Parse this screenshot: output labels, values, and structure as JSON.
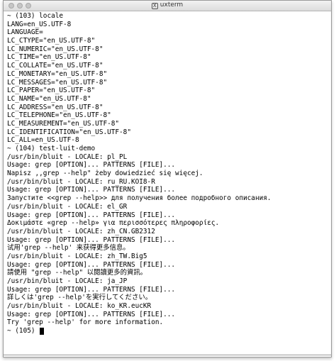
{
  "window": {
    "title": "uxterm",
    "title_icon": "x11-icon"
  },
  "terminal": {
    "lines": [
      "~ (103) locale",
      "LANG=en_US.UTF-8",
      "LANGUAGE=",
      "LC_CTYPE=\"en_US.UTF-8\"",
      "LC_NUMERIC=\"en_US.UTF-8\"",
      "LC_TIME=\"en_US.UTF-8\"",
      "LC_COLLATE=\"en_US.UTF-8\"",
      "LC_MONETARY=\"en_US.UTF-8\"",
      "LC_MESSAGES=\"en_US.UTF-8\"",
      "LC_PAPER=\"en_US.UTF-8\"",
      "LC_NAME=\"en_US.UTF-8\"",
      "LC_ADDRESS=\"en_US.UTF-8\"",
      "LC_TELEPHONE=\"en_US.UTF-8\"",
      "LC_MEASUREMENT=\"en_US.UTF-8\"",
      "LC_IDENTIFICATION=\"en_US.UTF-8\"",
      "LC_ALL=en_US.UTF-8",
      "~ (104) test-luit-demo",
      "/usr/bin/bluit - LOCALE: pl_PL",
      "Usage: grep [OPTION]... PATTERNS [FILE]...",
      "Napisz ,,grep --help\" żeby dowiedzieć się więcej.",
      "/usr/bin/bluit - LOCALE: ru_RU.KOI8-R",
      "Usage: grep [OPTION]... PATTERNS [FILE]...",
      "Запустите <<grep --help>> для получения более подробного описания.",
      "/usr/bin/bluit - LOCALE: el_GR",
      "Usage: grep [OPTION]... PATTERNS [FILE]...",
      "Δοκιμάστε «grep --help» για περισσότερες πληροφορίες.",
      "/usr/bin/bluit - LOCALE: zh_CN.GB2312",
      "Usage: grep [OPTION]... PATTERNS [FILE]...",
      "试用'grep --help' 来获得更多信息。",
      "/usr/bin/bluit - LOCALE: zh_TW.Big5",
      "Usage: grep [OPTION]... PATTERNS [FILE]...",
      "請使用 \"grep --help\" 以閱讀更多的資訊。",
      "/usr/bin/bluit - LOCALE: ja_JP",
      "Usage: grep [OPTION]... PATTERNS [FILE]...",
      "詳しくは'grep --help'を実行してください。",
      "/usr/bin/bluit - LOCALE: ko_KR.eucKR",
      "Usage: grep [OPTION]... PATTERNS [FILE]...",
      "Try 'grep --help' for more information."
    ],
    "prompt": "~ (105) "
  }
}
